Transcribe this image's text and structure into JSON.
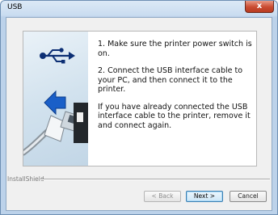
{
  "window": {
    "title": "USB",
    "close_label": "x"
  },
  "panel": {
    "steps": [
      "1. Make sure the printer power switch is on.",
      "2. Connect the USB interface cable to your PC, and then connect it to the printer.",
      "If you have already connected the USB interface cable to the printer, remove it and connect again."
    ]
  },
  "footer": {
    "installer_brand": "InstallShield",
    "back_label": "< Back",
    "next_label": "Next >",
    "cancel_label": "Cancel"
  },
  "colors": {
    "title_bar": "#c9dcf0",
    "close_button": "#c94b30",
    "arrow_blue": "#1a5fc8",
    "next_focus": "#3c7fb1"
  },
  "icons": [
    "close-icon",
    "usb-symbol-icon",
    "insert-arrow-icon",
    "usb-cable-plug-icon"
  ],
  "state": {
    "back_enabled": false,
    "default_button": "next"
  }
}
